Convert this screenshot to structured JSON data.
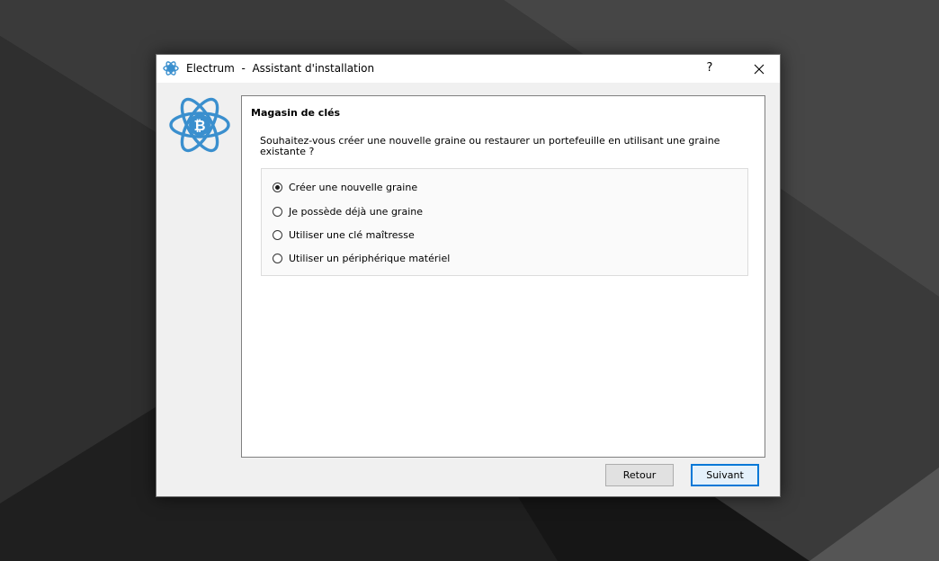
{
  "window": {
    "app_name": "Electrum",
    "separator": "-",
    "subtitle": "Assistant d'installation",
    "help_label": "?",
    "close_label": "✕"
  },
  "page": {
    "heading": "Magasin de clés",
    "question": "Souhaitez-vous créer une nouvelle graine ou restaurer un portefeuille en utilisant une graine existante ?"
  },
  "options": [
    {
      "label": "Créer une nouvelle graine",
      "selected": true
    },
    {
      "label": "Je possède déjà une graine",
      "selected": false
    },
    {
      "label": "Utiliser une clé maîtresse",
      "selected": false
    },
    {
      "label": "Utiliser un périphérique matériel",
      "selected": false
    }
  ],
  "buttons": {
    "back_label": "Retour",
    "next_label": "Suivant"
  },
  "colors": {
    "accent": "#0078d7",
    "logo_blue": "#3a8fce"
  }
}
